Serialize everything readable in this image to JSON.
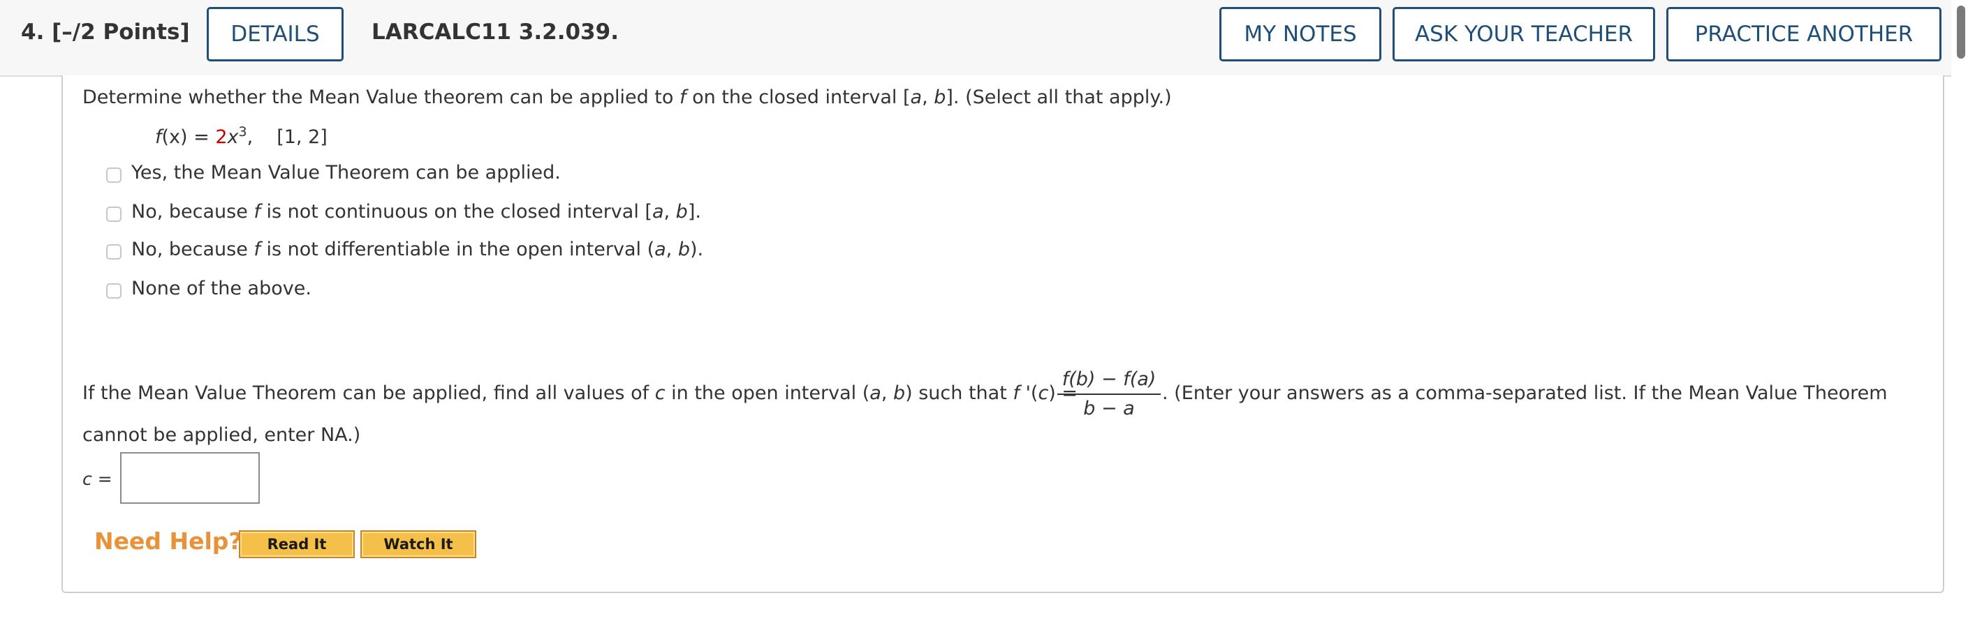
{
  "header": {
    "question_label": "4.  [–/2 Points]",
    "details_label": "DETAILS",
    "assignment_code": "LARCALC11 3.2.039.",
    "my_notes_label": "MY NOTES",
    "ask_teacher_label": "ASK YOUR TEACHER",
    "practice_label": "PRACTICE ANOTHER"
  },
  "question": {
    "prompt_pre": "Determine whether the Mean Value theorem can be applied to ",
    "prompt_f": "f",
    "prompt_mid": " on the closed interval [",
    "prompt_a": "a",
    "prompt_comma": ", ",
    "prompt_b": "b",
    "prompt_post": "]. (Select all that apply.)",
    "func_f": "f",
    "func_lhs": "(x) = ",
    "func_coef": "2",
    "func_x": "x",
    "func_exp": "3",
    "func_comma": ",",
    "func_interval": "[1, 2]"
  },
  "options": {
    "o1": "Yes, the Mean Value Theorem can be applied.",
    "o2_pre": "No, because ",
    "o2_f": "f",
    "o2_mid": " is not continuous on the closed interval [",
    "o2_a": "a",
    "o2_sep": ", ",
    "o2_b": "b",
    "o2_post": "].",
    "o3_pre": "No, because ",
    "o3_f": "f",
    "o3_mid": " is not differentiable in the open interval (",
    "o3_a": "a",
    "o3_sep": ", ",
    "o3_b": "b",
    "o3_post": ").",
    "o4": "None of the above."
  },
  "part2": {
    "pre": "If the Mean Value Theorem can be applied, find all values of ",
    "c": "c",
    "mid": " in the open interval (",
    "a": "a",
    "sep": ", ",
    "b": "b",
    "mid2": ") such that ",
    "fprime": "f",
    "fprime_rest": " '(",
    "c2": "c",
    "eq": ") = ",
    "frac_num": "f(b) − f(a)",
    "frac_den": "b − a",
    "post": ". (Enter your answers as a comma-separated list. If the Mean Value Theorem",
    "line2": "cannot be applied, enter NA.)",
    "answer_c": "c",
    "answer_eq": " =",
    "answer_value": ""
  },
  "help": {
    "need_help": "Need Help?",
    "read_it": "Read It",
    "watch_it": "Watch It"
  },
  "colors": {
    "header_button_border": "#1f4e79",
    "coefficient_red": "#cc0000",
    "need_help_orange": "#e8923a",
    "help_button_fill": "#f5c04a"
  }
}
